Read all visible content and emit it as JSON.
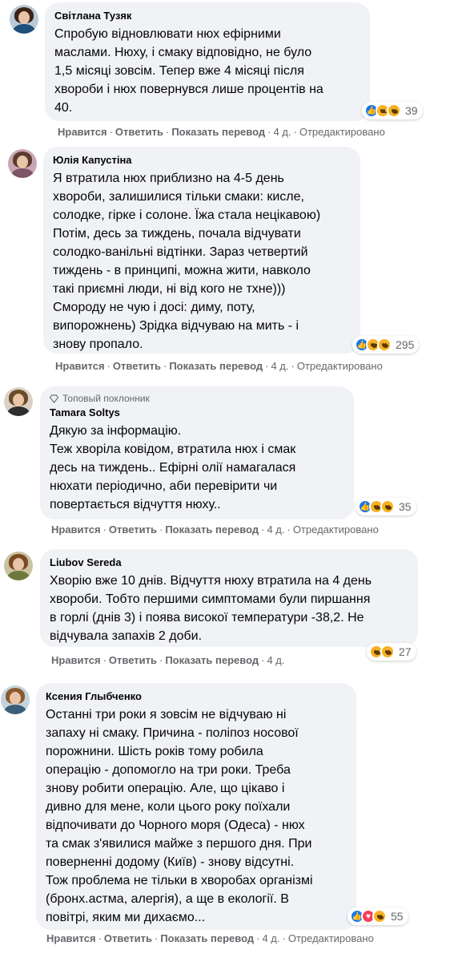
{
  "comments": [
    {
      "author": "Світлана Тузяк",
      "text": "Спробую відновлювати нюх ефірними\nмаслами. Нюху, і смаку відповідно, не було\n1,5 місяці зовсім. Тепер вже 4 місяці після\nхвороби і нюх повернувся лише процентів на\n40.",
      "reactions": [
        "like",
        "sad",
        "wow"
      ],
      "reaction_count": "39",
      "actions": {
        "like": "Нравится",
        "reply": "Ответить",
        "translate": "Показать перевод",
        "time": "4 д.",
        "edited": "Отредактировано"
      }
    },
    {
      "author": "Юлія Капустіна",
      "text": "Я втратила нюх приблизно на 4-5 день\nхвороби, залишилися тільки смаки: кисле,\nсолодке, гірке і солоне. Їжа стала нецікавою)\nПотім, десь за тиждень, почала відчувати\nсолодко-ванільні відтінки. Зараз четвертий\nтиждень - в принципі, можна жити, навколо\nтакі приємні люди, ні від кого не тхне)))\nСмороду не чую і досі: диму, поту,\nвипорожнень) Зрідка відчуваю на мить - і\nзнову пропало.",
      "reactions": [
        "like",
        "haha",
        "wow"
      ],
      "reaction_count": "295",
      "actions": {
        "like": "Нравится",
        "reply": "Ответить",
        "translate": "Показать перевод",
        "time": "4 д.",
        "edited": "Отредактировано"
      }
    },
    {
      "badge": "Топовый поклонник",
      "author": "Tamara Soltys",
      "text": "Дякую за інформацію.\nТеж хворіла ковідом, втратила нюх і смак\nдесь на тиждень.. Ефірні олії намагалася\nнюхати періодично, аби перевірити чи\nповертається відчуття нюху..",
      "reactions": [
        "like",
        "wow",
        "care"
      ],
      "reaction_count": "35",
      "actions": {
        "like": "Нравится",
        "reply": "Ответить",
        "translate": "Показать перевод",
        "time": "4 д.",
        "edited": "Отредактировано"
      }
    },
    {
      "author": "Liubov Sereda",
      "text": "Хворію вже 10 днів. Відчуття нюху втратила на 4 день\nхвороби. Тобто першими симптомами були пиршання\nв горлі (днів 3) і поява високої температури -38,2. Не\nвідчувала запахів 2 доби.",
      "reactions": [
        "care",
        "wow"
      ],
      "reaction_count": "27",
      "actions": {
        "like": "Нравится",
        "reply": "Ответить",
        "translate": "Показать перевод",
        "time": "4 д.",
        "edited": ""
      }
    },
    {
      "author": "Ксения Глыбченко",
      "text": "Останні три роки я зовсім не відчуваю ні\nзапаху ні смаку. Причина - поліпоз носової\nпорожнини. Шість років тому робила\nоперацію - допомогло на три роки. Треба\nзнову робити операцію. Але, що цікаво і\nдивно для мене, коли цього року поїхали\nвідпочивати до Чорного моря (Одеса) - нюх\nта смак з'явилися майже з першого дня. При\nповерненні додому (Київ) - знову відсутні.\nТож проблема не тільки в хворобах організмі\n(бронх.астма, алергія), а ще в екології. В\nповітрі, яким ми дихаємо...",
      "reactions": [
        "like",
        "love",
        "wow"
      ],
      "reaction_count": "55",
      "actions": {
        "like": "Нравится",
        "reply": "Ответить",
        "translate": "Показать перевод",
        "time": "4 д.",
        "edited": "Отредактировано"
      }
    }
  ],
  "colors": {
    "bubble": "#f0f2f5",
    "meta_text": "#65676b",
    "like_blue": "#1877f2",
    "emoji_yellow": "#f7b125",
    "love_red": "#f33e58"
  }
}
